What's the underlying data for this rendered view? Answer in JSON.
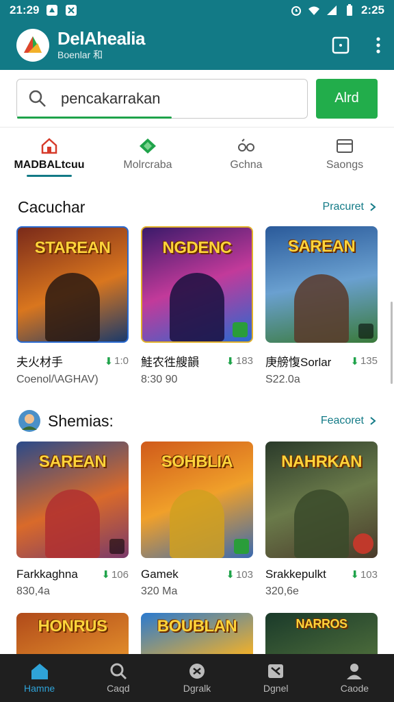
{
  "status_bar": {
    "time": "21:29",
    "battery": "2:25"
  },
  "header": {
    "title": "DelAhealia",
    "subtitle": "Boenlar 和"
  },
  "search": {
    "value": "pencakarrakan",
    "button_label": "Alrd"
  },
  "tabs": [
    {
      "label": "MADBALtcuu",
      "icon": "home-icon",
      "active": true
    },
    {
      "label": "Molrcraba",
      "icon": "diamond-icon",
      "active": false
    },
    {
      "label": "Gchna",
      "icon": "people-icon",
      "active": false
    },
    {
      "label": "Saongs",
      "icon": "card-icon",
      "active": false
    }
  ],
  "sections": [
    {
      "title": "Cacuchar",
      "link": "Pracuret",
      "items": [
        {
          "art": "STAREAN",
          "name": "夫火材手",
          "rating": "1:0",
          "price": "Coenol/\\AGHAV)",
          "colors": [
            "#7a2a1a",
            "#d9761e",
            "#1b3a6a"
          ]
        },
        {
          "art": "NGDENC",
          "name": "鮭农徃艘韻",
          "rating": "183",
          "price": "8:30 90",
          "colors": [
            "#3a1a6a",
            "#c23a9a",
            "#2a6ad0"
          ]
        },
        {
          "art": "SAREAN",
          "name": "庚艕愎Sorlar",
          "rating": "135",
          "price": "S22.0a",
          "colors": [
            "#2a5a9a",
            "#6aa0d0",
            "#3a7a3a"
          ]
        }
      ]
    },
    {
      "title": "Shemias:",
      "link": "Feacoret",
      "items": [
        {
          "art": "SAREAN",
          "name": "Farkkaghna",
          "rating": "106",
          "price": "830,4a",
          "colors": [
            "#2a4a8a",
            "#d96a2a",
            "#7a3a6a"
          ]
        },
        {
          "art": "SOHBLIA",
          "name": "Gamek",
          "rating": "103",
          "price": "320 Ma",
          "colors": [
            "#d05a1a",
            "#f0a02a",
            "#3a6ab0"
          ]
        },
        {
          "art": "NAHRKAN",
          "name": "Srakkepulkt",
          "rating": "103",
          "price": "320,6e",
          "colors": [
            "#2a3a2a",
            "#6a7a4a",
            "#4a3a2a"
          ]
        }
      ]
    },
    {
      "items": [
        {
          "art": "HONRUS",
          "colors": [
            "#b04a1a",
            "#e08a2a"
          ]
        },
        {
          "art": "BOUBLAN",
          "colors": [
            "#2a7ad0",
            "#f0b02a"
          ]
        },
        {
          "art": "NARROS",
          "colors": [
            "#1a3a2a",
            "#4a6a3a"
          ]
        }
      ]
    }
  ],
  "bottom_nav": [
    {
      "label": "Hamne",
      "icon": "home-icon",
      "active": true
    },
    {
      "label": "Caqd",
      "icon": "search-icon",
      "active": false
    },
    {
      "label": "Dgralk",
      "icon": "chat-icon",
      "active": false
    },
    {
      "label": "Dgnel",
      "icon": "message-icon",
      "active": false
    },
    {
      "label": "Caode",
      "icon": "profile-icon",
      "active": false
    }
  ],
  "colors": {
    "primary": "#127a86",
    "accent": "#22ad4b",
    "nav_active": "#2fa3d8"
  }
}
